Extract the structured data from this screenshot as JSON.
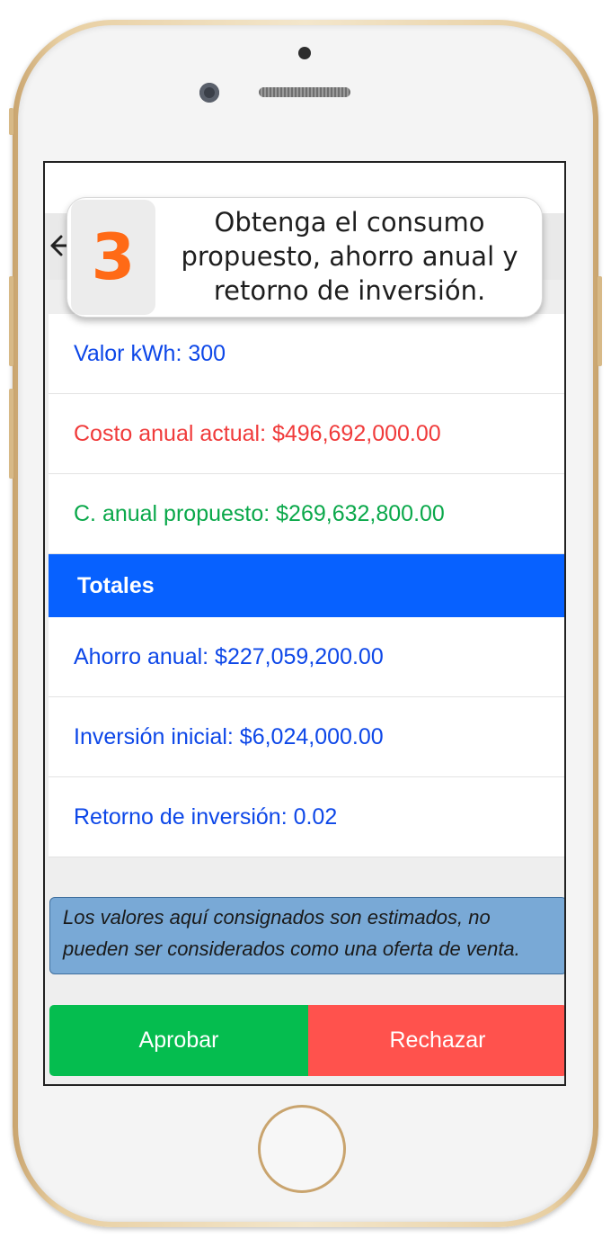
{
  "callout": {
    "step": "3",
    "text": "Obtenga el consumo propuesto, ahorro anual y retorno de inversión."
  },
  "rows_top": [
    {
      "label": "Valor kWh: 300"
    },
    {
      "label": "Costo anual actual: $496,692,000.00"
    },
    {
      "label": "C. anual propuesto: $269,632,800.00"
    }
  ],
  "totals": {
    "header": "Totales",
    "rows": [
      {
        "label": "Ahorro anual: $227,059,200.00"
      },
      {
        "label": "Inversión inicial: $6,024,000.00"
      },
      {
        "label": "Retorno de inversión: 0.02"
      }
    ]
  },
  "disclaimer": "Los valores aquí consignados son estimados, no pueden ser considerados como una oferta de venta.",
  "actions": {
    "approve": "Aprobar",
    "reject": "Rechazar"
  },
  "colors": {
    "header_blue": "#0761ff",
    "value_blue": "#0d47e8",
    "current_cost_red": "#f03b3b",
    "proposed_cost_green": "#0aa84a",
    "approve_green": "#05bd4f",
    "reject_red": "#ff524d",
    "step_orange": "#ff6a16"
  },
  "icons": {
    "back": "arrow-left-icon"
  }
}
